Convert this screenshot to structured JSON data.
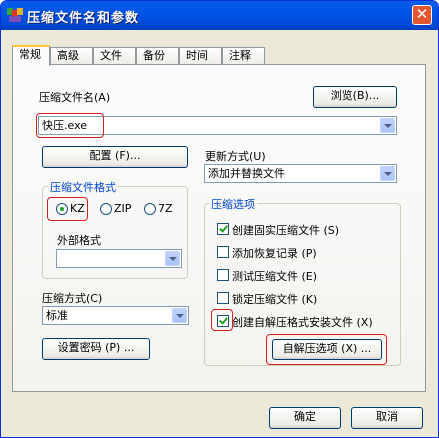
{
  "window": {
    "title": "压缩文件名和参数"
  },
  "tabs": [
    {
      "label": "常规",
      "active": true
    },
    {
      "label": "高级"
    },
    {
      "label": "文件"
    },
    {
      "label": "备份"
    },
    {
      "label": "时间"
    },
    {
      "label": "注释"
    }
  ],
  "general": {
    "archive_name_label": "压缩文件名(A)",
    "archive_name_value": "快压.exe",
    "browse_button": "浏览(B)...",
    "config_button": "配置 (F)...",
    "update_mode_label": "更新方式(U)",
    "update_mode_value": "添加并替换文件",
    "format_group_title": "压缩文件格式",
    "formats": [
      {
        "label": "KZ",
        "selected": true
      },
      {
        "label": "ZIP",
        "selected": false
      },
      {
        "label": "7Z",
        "selected": false
      }
    ],
    "external_format_label": "外部格式",
    "external_format_value": "",
    "method_label": "压缩方式(C)",
    "method_value": "标准",
    "password_button": "设置密码 (P) ...",
    "options_group_title": "压缩选项",
    "options": [
      {
        "label": "创建固实压缩文件 (S)",
        "checked": true
      },
      {
        "label": "添加恢复记录 (P)",
        "checked": false
      },
      {
        "label": "测试压缩文件 (E)",
        "checked": false
      },
      {
        "label": "锁定压缩文件 (K)",
        "checked": false
      },
      {
        "label": "创建自解压格式安装文件 (X)",
        "checked": true
      }
    ],
    "sfx_button": "自解压选项 (X) ..."
  },
  "footer": {
    "ok_button": "确定",
    "cancel_button": "取消"
  },
  "colors": {
    "title_bar": "#0055ea",
    "highlight": "#d61f1f",
    "group_title": "#0046d5"
  }
}
